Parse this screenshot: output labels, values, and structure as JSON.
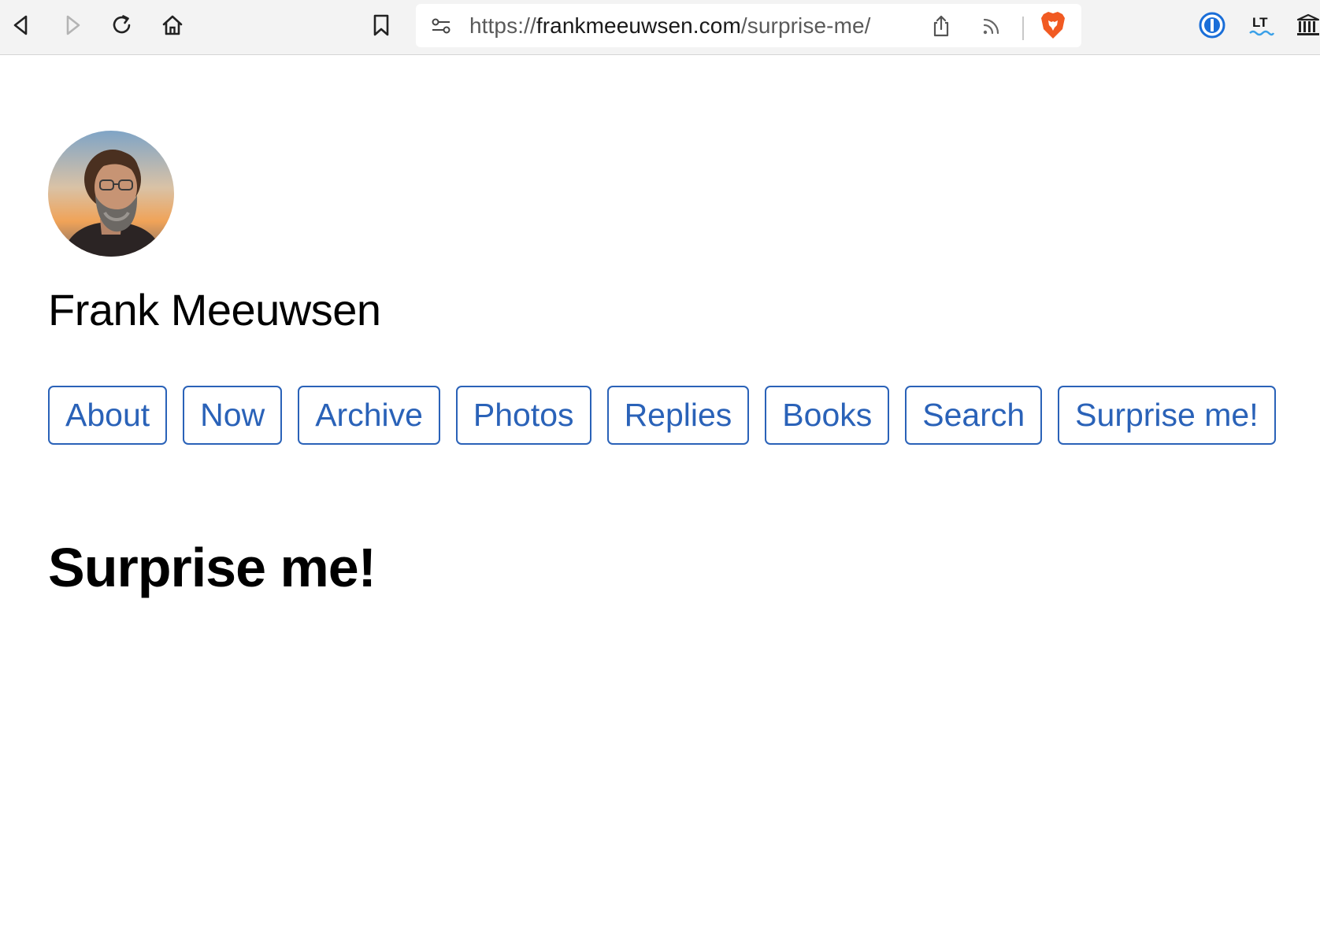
{
  "browser": {
    "url_scheme": "https://",
    "url_host": "frankmeeuwsen.com",
    "url_path": "/surprise-me/",
    "extension_lt_label": "LT",
    "colors": {
      "brave_orange": "#f15a22",
      "onepassword_blue": "#1a6ed8"
    },
    "icons": [
      "back-icon",
      "forward-icon",
      "reload-icon",
      "home-icon",
      "bookmark-icon",
      "site-settings-icon",
      "share-icon",
      "rss-icon",
      "brave-shields-icon",
      "onepassword-icon",
      "languagetool-icon",
      "library-icon"
    ]
  },
  "site": {
    "title": "Frank Meeuwsen",
    "avatar_icon": "profile-photo",
    "link_color": "#2a62b8"
  },
  "nav": {
    "items": [
      {
        "label": "About"
      },
      {
        "label": "Now"
      },
      {
        "label": "Archive"
      },
      {
        "label": "Photos"
      },
      {
        "label": "Replies"
      },
      {
        "label": "Books"
      },
      {
        "label": "Search"
      },
      {
        "label": "Surprise me!"
      }
    ]
  },
  "page": {
    "heading": "Surprise me!"
  }
}
